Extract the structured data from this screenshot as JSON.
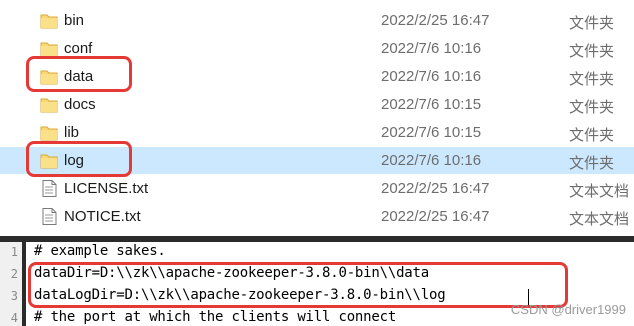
{
  "files": [
    {
      "name": "bin",
      "modified": "2022/2/25 16:47",
      "type": "文件夹",
      "kind": "folder",
      "selected": false
    },
    {
      "name": "conf",
      "modified": "2022/7/6 10:16",
      "type": "文件夹",
      "kind": "folder",
      "selected": false
    },
    {
      "name": "data",
      "modified": "2022/7/6 10:16",
      "type": "文件夹",
      "kind": "folder",
      "selected": false
    },
    {
      "name": "docs",
      "modified": "2022/7/6 10:15",
      "type": "文件夹",
      "kind": "folder",
      "selected": false
    },
    {
      "name": "lib",
      "modified": "2022/7/6 10:15",
      "type": "文件夹",
      "kind": "folder",
      "selected": false
    },
    {
      "name": "log",
      "modified": "2022/7/6 10:16",
      "type": "文件夹",
      "kind": "folder",
      "selected": true
    },
    {
      "name": "LICENSE.txt",
      "modified": "2022/2/25 16:47",
      "type": "文本文档",
      "kind": "text",
      "selected": false
    },
    {
      "name": "NOTICE.txt",
      "modified": "2022/2/25 16:47",
      "type": "文本文档",
      "kind": "text",
      "selected": false
    }
  ],
  "editor": {
    "lines": [
      {
        "num": "1",
        "text": "# example sakes."
      },
      {
        "num": "2",
        "text": "dataDir=D:\\\\zk\\\\apache-zookeeper-3.8.0-bin\\\\data"
      },
      {
        "num": "3",
        "text": "dataLogDir=D:\\\\zk\\\\apache-zookeeper-3.8.0-bin\\\\log"
      },
      {
        "num": "4",
        "text": "# the port at which the clients will connect"
      }
    ]
  },
  "watermark": "CSDN @driver1999",
  "colors": {
    "callout": "#e53935",
    "selected_row": "#cce8ff",
    "folder": "#f8d775"
  }
}
